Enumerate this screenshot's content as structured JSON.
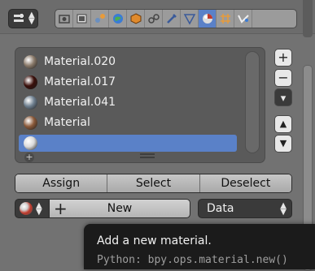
{
  "header": {
    "editor_type_icon": "properties-editor-icon",
    "context_tabs": [
      {
        "name": "render-icon",
        "active": false
      },
      {
        "name": "render-layers-icon",
        "active": false
      },
      {
        "name": "scene-icon",
        "active": false
      },
      {
        "name": "world-icon",
        "active": false
      },
      {
        "name": "object-icon",
        "active": false
      },
      {
        "name": "constraints-icon",
        "active": false
      },
      {
        "name": "modifiers-icon",
        "active": false
      },
      {
        "name": "data-icon",
        "active": false
      },
      {
        "name": "material-icon",
        "active": true
      },
      {
        "name": "texture-icon",
        "active": false
      },
      {
        "name": "particles-icon",
        "active": false
      }
    ]
  },
  "material_slots": [
    {
      "label": "Material.020",
      "color": "#8a7a6a"
    },
    {
      "label": "Material.017",
      "color": "#3a0f0a"
    },
    {
      "label": "Material.041",
      "color": "#6f8090"
    },
    {
      "label": "Material",
      "color": "#8b5a3a"
    },
    {
      "label": "",
      "color": "#d9d9d9",
      "selected": true
    }
  ],
  "side_buttons": {
    "add": "+",
    "remove": "−",
    "specials": "▾",
    "move_up": "▲",
    "move_down": "▼"
  },
  "slot_actions": {
    "assign": "Assign",
    "select": "Select",
    "deselect": "Deselect"
  },
  "datablock": {
    "new_label": "New",
    "link_label": "Data"
  },
  "tooltip": {
    "title": "Add a new material.",
    "python": "Python: bpy.ops.material.new()"
  },
  "colors": {
    "accent": "#5a81c8",
    "background": "#727272",
    "tooltip_bg": "#1b1b1b"
  }
}
